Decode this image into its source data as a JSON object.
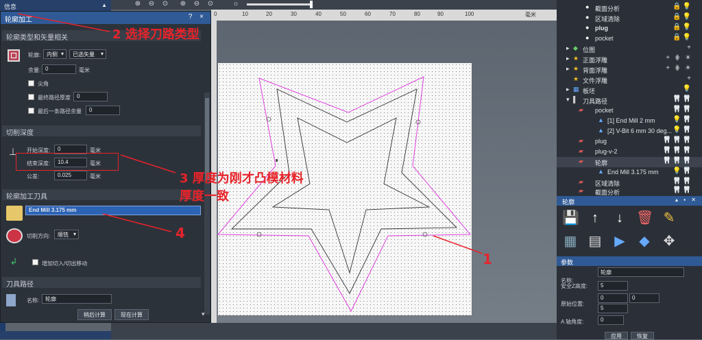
{
  "left_header": {
    "title": "信息"
  },
  "panel": {
    "title": "轮廓加工",
    "controls": "? × ",
    "section1": "轮廓类型和矢量相关",
    "contour_label": "轮廓:",
    "contour_type": "内侧",
    "vector_select": "已选矢量",
    "allowance_label": "余量:",
    "allowance_value": "0",
    "allowance_unit": "毫米",
    "sharp_corner": "尖角",
    "final_depth_label": "最终路径厚度",
    "final_depth_value": "0",
    "last_allowance_label": "最后一条路径余量",
    "last_allowance_value": "0",
    "section2": "切削深度",
    "start_depth_label": "开始深度:",
    "start_depth_value": "0",
    "start_depth_unit": "毫米",
    "end_depth_label": "结束深度:",
    "end_depth_value": "10.4",
    "end_depth_unit": "毫米",
    "tolerance_label": "公差:",
    "tolerance_value": "0.025",
    "tolerance_unit": "毫米",
    "section3": "轮廓加工刀具",
    "tool_name": "End Mill 3.175 mm",
    "cut_dir_label": "切削方向:",
    "cut_dir_value": "顺铣",
    "leadin_label": "增加切入/切出移动",
    "section4": "刀具路径",
    "name_label": "名称:",
    "name_value": "轮廓",
    "btn_calc_later": "稍后计算",
    "btn_calc_now": "现在计算"
  },
  "ruler": {
    "ticks": [
      "0",
      "10",
      "20",
      "30",
      "40",
      "50",
      "60",
      "70",
      "80",
      "90",
      "100"
    ],
    "unit": "毫米"
  },
  "annotations": {
    "a1": "2 选择刀路类型",
    "a2": "3 厚度为刚才凸模材料",
    "a2b": "厚度一致",
    "a3": "4",
    "a4": "1"
  },
  "tree": {
    "items": [
      {
        "label": "截面分析"
      },
      {
        "label": "区域清除"
      },
      {
        "label": "plug"
      },
      {
        "label": "pocket"
      },
      {
        "label": "位图"
      },
      {
        "label": "正面浮雕"
      },
      {
        "label": "背面浮雕"
      },
      {
        "label": "文件浮雕"
      },
      {
        "label": "板坯"
      },
      {
        "label": "刀具路径"
      },
      {
        "label": "pocket"
      },
      {
        "label": "[1] End Mill 2 mm"
      },
      {
        "label": "[2] V-Bit 6 mm 30 deg..."
      },
      {
        "label": "plug"
      },
      {
        "label": "plug-v-2"
      },
      {
        "label": "轮廓"
      },
      {
        "label": "End Mill 3.175 mm"
      },
      {
        "label": "区域清除"
      },
      {
        "label": "截面分析"
      }
    ]
  },
  "rsub": {
    "title": "轮廓"
  },
  "params": {
    "title": "参数",
    "name_label": "名称:",
    "name_value": "轮廓",
    "safez_label": "安全Z高度:",
    "safez_value": "5",
    "home_label": "原始位置:",
    "home_x": "0",
    "home_y": "0",
    "home_z": "5",
    "aangle_label": "A 轴角度:",
    "aangle_value": "0",
    "apply": "应用",
    "restore": "恢复"
  },
  "colors": {
    "accent_blue": "#2f5a96",
    "annotation_red": "#e8232a",
    "toolpath_magenta": "#e040e0"
  }
}
